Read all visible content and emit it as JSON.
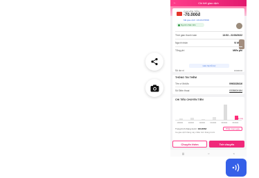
{
  "side_actions": {
    "share_icon": "share-icon",
    "camera_icon": "camera-icon"
  },
  "app": {
    "title": "Chi tiết giao dịch",
    "back_icon": "back-arrow-icon"
  },
  "transaction": {
    "label": "CHUYỂN TIỀN",
    "amount": "-70.000đ",
    "reference": "Mã giao dịch: 22129476830",
    "status": "Người nhận tiền",
    "rows": [
      {
        "label": "Thời gian thanh toán",
        "value": "13:53 - 21/03/2022"
      },
      {
        "label": "Người nhận",
        "value": "Vi Minh"
      },
      {
        "label": "Tổng phí",
        "value": "Miễn phí"
      }
    ],
    "link_text": "Liên hệ hỗ trợ",
    "balance_label": "Số dư ví",
    "balance_value": "••••••••••"
  },
  "info": {
    "title": "THÔNG TIN THÊM",
    "rows": [
      {
        "label": "Tên ví MoMo",
        "value": "0963328416"
      },
      {
        "label": "Số Điện thoại",
        "value": "0335824184"
      }
    ]
  },
  "chart_section": {
    "title": "CHI TIÊU CHUYỂN TIỀN",
    "marker": "Hôm nay",
    "summary_label": "Trung bình tháng trước:",
    "summary_value": "184.865đ",
    "note": "Ca giao dịch tháng này nhiều hơn tháng trước",
    "pill": "Phân loại ngay"
  },
  "chart_data": {
    "type": "bar",
    "categories": [
      "10/2021",
      "11/2021",
      "12/2021",
      "01/2022",
      "02/2022",
      "03/2022"
    ],
    "values": [
      2,
      3,
      1,
      4,
      22,
      6
    ],
    "title": "",
    "xlabel": "",
    "ylabel": ""
  },
  "actions": {
    "secondary": "Chuyển thêm",
    "primary": "Trở chuyển"
  },
  "nav": [
    "|||",
    "○",
    "<"
  ],
  "voice_icon": "voice-wave-icon",
  "colors": {
    "brand": "#e2196e",
    "accent_blue": "#3560e8"
  }
}
